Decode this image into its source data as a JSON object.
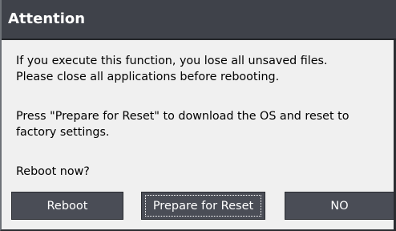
{
  "dialog": {
    "title": "Attention",
    "message_lines": [
      "If you execute this function, you lose all unsaved files.",
      "Please close all applications before rebooting.",
      "Press \"Prepare for Reset\" to download the OS and reset to",
      "factory settings.",
      "Reboot now?"
    ],
    "buttons": {
      "reboot_label": "Reboot",
      "prepare_label": "Prepare for Reset",
      "no_label": "NO"
    }
  },
  "colors": {
    "titlebar": "#3f424a",
    "button": "#4a4d56",
    "body_background": "#f0f0f0"
  }
}
